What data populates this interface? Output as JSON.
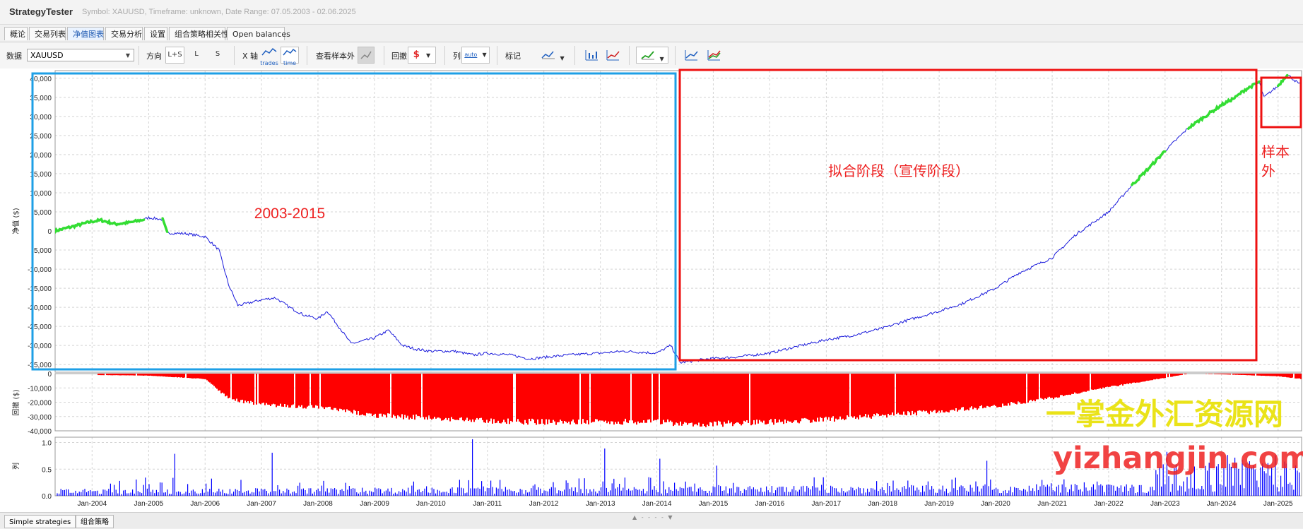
{
  "app": {
    "title": "StrategyTester",
    "subtitle": "Symbol: XAUUSD, Timeframe: unknown, Date Range: 07.05.2003 - 02.06.2025"
  },
  "tabs": [
    "概论",
    "交易列表",
    "净值图表",
    "交易分析",
    "设置",
    "组合策略相关性",
    "Open balances"
  ],
  "active_tab": "净值图表",
  "toolbar": {
    "data_label": "数据",
    "data_value": "XAUUSD",
    "direction_label": "方向",
    "direction_options": [
      "L+S",
      "L",
      "S"
    ],
    "xaxis_label": "X 轴",
    "xaxis_options": [
      "trades",
      "time"
    ],
    "oos_label": "查看样本外",
    "drawdown_label": "回撤",
    "column_label": "列",
    "column_value": "auto",
    "marker_label": "标记"
  },
  "bottom_tabs": [
    "Simple strategies",
    "组合策略"
  ],
  "splitter_glyph": "▲ - - - - ▼",
  "annotations": {
    "box1_label": "2003-2015",
    "box2_label": "拟合阶段（宣传阶段）",
    "box3_label": "样本外",
    "watermark_cn": "一掌金外汇资源网",
    "watermark_url": "yizhangjin.com"
  },
  "colors": {
    "equity_line": "#1a1adb",
    "highlight": "#33dd33",
    "drawdown": "#ff0000",
    "volume": "#0000ff",
    "box_blue": "#1e9fe6",
    "box_red": "#ee1111",
    "annotation_red": "#ee2222",
    "watermark_cn": "#e8e000",
    "watermark_url": "#ee2222"
  },
  "chart_data": [
    {
      "type": "line",
      "ylabel": "净值 ($)",
      "ylim": [
        -37000,
        42000
      ],
      "yticks": [
        40000,
        35000,
        30000,
        25000,
        20000,
        15000,
        10000,
        5000,
        0,
        -5000,
        -10000,
        -15000,
        -20000,
        -25000,
        -30000,
        -35000
      ],
      "ytick_labels": [
        "40,000",
        "35,000",
        "30,000",
        "25,000",
        "20,000",
        "15,000",
        "10,000",
        "5,000",
        "0",
        "-5,000",
        "-10,000",
        "-15,000",
        "-20,000",
        "-25,000",
        "-30,000",
        "-35,000"
      ],
      "x_range": [
        "2003-05-07",
        "2025-06-02"
      ],
      "grid": true,
      "x": [
        "2003-05-07",
        "2003-10-01",
        "2004-01-01",
        "2004-03-01",
        "2004-06-01",
        "2004-09-01",
        "2004-12-01",
        "2005-01-01",
        "2005-04-01",
        "2005-05-01",
        "2005-09-01",
        "2006-01-01",
        "2006-04-01",
        "2006-06-01",
        "2006-08-01",
        "2006-10-01",
        "2007-01-01",
        "2007-04-01",
        "2007-07-01",
        "2007-10-01",
        "2008-01-01",
        "2008-03-01",
        "2008-06-01",
        "2008-08-01",
        "2008-10-01",
        "2009-01-01",
        "2009-04-01",
        "2009-07-01",
        "2009-10-01",
        "2010-01-01",
        "2010-06-01",
        "2010-10-01",
        "2011-01-01",
        "2011-06-01",
        "2011-10-01",
        "2012-06-01",
        "2013-01-01",
        "2013-06-01",
        "2014-01-01",
        "2014-04-01",
        "2014-06-01",
        "2014-12-01",
        "2015-06-01",
        "2016-01-01",
        "2016-06-01",
        "2017-01-01",
        "2017-06-01",
        "2018-01-01",
        "2018-06-01",
        "2019-01-01",
        "2019-06-01",
        "2020-01-01",
        "2020-06-01",
        "2021-01-01",
        "2021-06-01",
        "2022-01-01",
        "2022-06-01",
        "2022-10-01",
        "2023-01-01",
        "2023-06-01",
        "2024-01-01",
        "2024-04-01",
        "2024-06-01",
        "2024-09-01",
        "2024-10-01",
        "2025-01-01",
        "2025-03-01",
        "2025-06-02"
      ],
      "values": [
        0,
        1500,
        2500,
        2800,
        1800,
        2200,
        3000,
        3500,
        3000,
        -500,
        -700,
        -1500,
        -5000,
        -14000,
        -19500,
        -19000,
        -18000,
        -17500,
        -20000,
        -22000,
        -23000,
        -21000,
        -26000,
        -29500,
        -29000,
        -28000,
        -26000,
        -30000,
        -31000,
        -31500,
        -31500,
        -32500,
        -32000,
        -32500,
        -33500,
        -32500,
        -32000,
        -31500,
        -32000,
        -30000,
        -34500,
        -33500,
        -33000,
        -32000,
        -30500,
        -28500,
        -27500,
        -25500,
        -23500,
        -21000,
        -19000,
        -15000,
        -11000,
        -7000,
        -1000,
        5000,
        12000,
        17000,
        21000,
        27000,
        33000,
        35000,
        37000,
        39000,
        35000,
        38000,
        41000,
        38000
      ],
      "highlight_segments": [
        [
          "2003-05-07",
          "2004-12-01"
        ],
        [
          "2005-04-01",
          "2005-05-01"
        ],
        [
          "2022-06-01",
          "2023-01-01"
        ],
        [
          "2023-06-01",
          "2024-09-01"
        ],
        [
          "2025-01-01",
          "2025-03-01"
        ]
      ]
    },
    {
      "type": "area",
      "ylabel": "回撤 ($)",
      "ylim": [
        -40000,
        0
      ],
      "ytick_labels": [
        "0",
        "-10,000",
        "-20,000",
        "-30,000",
        "-40,000"
      ],
      "yticks": [
        0,
        -10000,
        -20000,
        -30000,
        -40000
      ],
      "x": [
        "2003-05-07",
        "2004-01-01",
        "2005-01-01",
        "2006-01-01",
        "2006-06-01",
        "2007-01-01",
        "2008-01-01",
        "2009-01-01",
        "2010-01-01",
        "2011-01-01",
        "2012-01-01",
        "2013-01-01",
        "2014-01-01",
        "2014-06-01",
        "2015-01-01",
        "2016-01-01",
        "2017-01-01",
        "2018-01-01",
        "2019-01-01",
        "2020-01-01",
        "2021-01-01",
        "2022-01-01",
        "2023-01-01",
        "2023-06-01",
        "2024-01-01",
        "2025-01-01",
        "2025-06-02"
      ],
      "values": [
        0,
        -1000,
        -1500,
        -4000,
        -19000,
        -23000,
        -25000,
        -31000,
        -33000,
        -35000,
        -36000,
        -36000,
        -35500,
        -37500,
        -37500,
        -36000,
        -34000,
        -31000,
        -28000,
        -24000,
        -18000,
        -10000,
        -3000,
        0,
        -500,
        -2000,
        -4000
      ]
    },
    {
      "type": "bar",
      "ylabel": "列",
      "ylim": [
        0,
        1.1
      ],
      "yticks": [
        1.0,
        0.5,
        0.0
      ],
      "ytick_labels": [
        "1.0",
        "0.5",
        "0.0"
      ],
      "x_tick_labels": [
        "Jan-2004",
        "Jan-2005",
        "Jan-2006",
        "Jan-2007",
        "Jan-2008",
        "Jan-2009",
        "Jan-2010",
        "Jan-2011",
        "Jan-2012",
        "Jan-2013",
        "Jan-2014",
        "Jan-2015",
        "Jan-2016",
        "Jan-2017",
        "Jan-2018",
        "Jan-2019",
        "Jan-2020",
        "Jan-2021",
        "Jan-2022",
        "Jan-2023",
        "Jan-2024",
        "Jan-2025"
      ],
      "typical_values": [
        0.1,
        0.15
      ],
      "peak_values": [
        0.4,
        0.35,
        0.3,
        0.9,
        1.1
      ]
    }
  ]
}
